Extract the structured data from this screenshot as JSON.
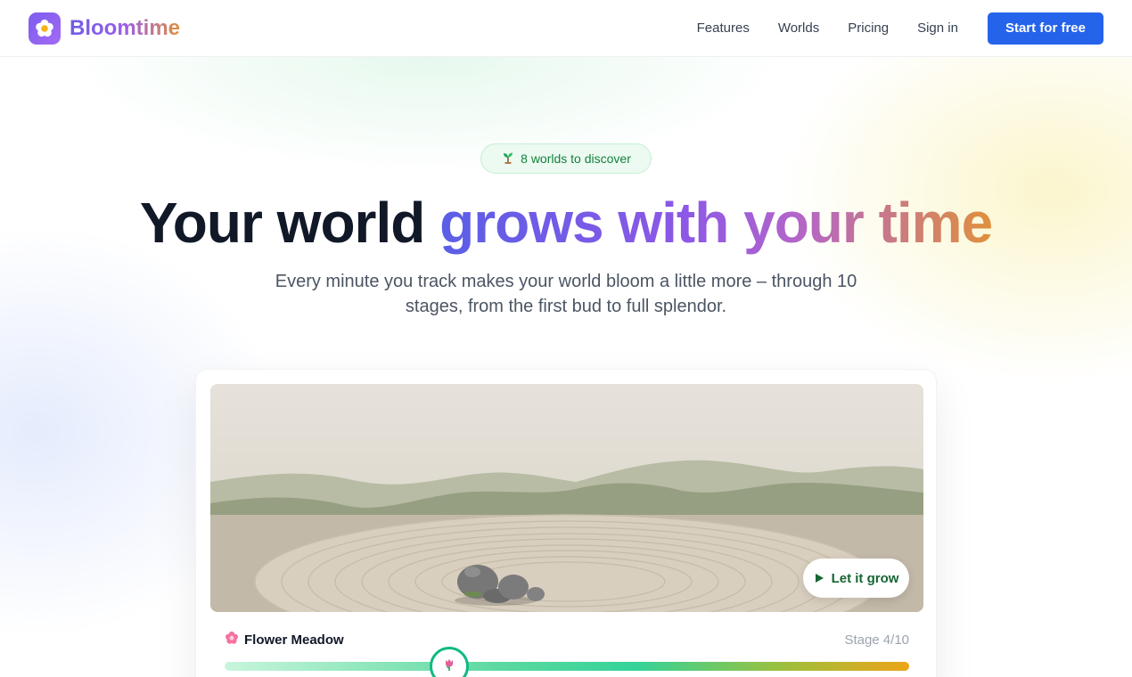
{
  "header": {
    "brand": "Bloomtime",
    "nav": [
      "Features",
      "Worlds",
      "Pricing",
      "Sign in"
    ],
    "cta_label": "Start for free"
  },
  "hero": {
    "badge_icon": "seedling-icon",
    "badge_text": "8 worlds to discover",
    "title_plain": "Your world",
    "title_gradient": "grows with your time",
    "subtitle": "Every minute you track makes your world bloom a little more – through 10 stages, from the first bud to full splendor."
  },
  "preview": {
    "action_label": "Let it grow",
    "world_icon": "flower-icon",
    "world_name": "Flower Meadow",
    "stage_label": "Stage 4/10",
    "stage_current": 4,
    "stage_total": 10,
    "slider_icon": "tulip-icon"
  },
  "colors": {
    "primary": "#2563eb",
    "brand": "#7c5cf0",
    "success": "#10b981",
    "accent": "#e0903c"
  }
}
